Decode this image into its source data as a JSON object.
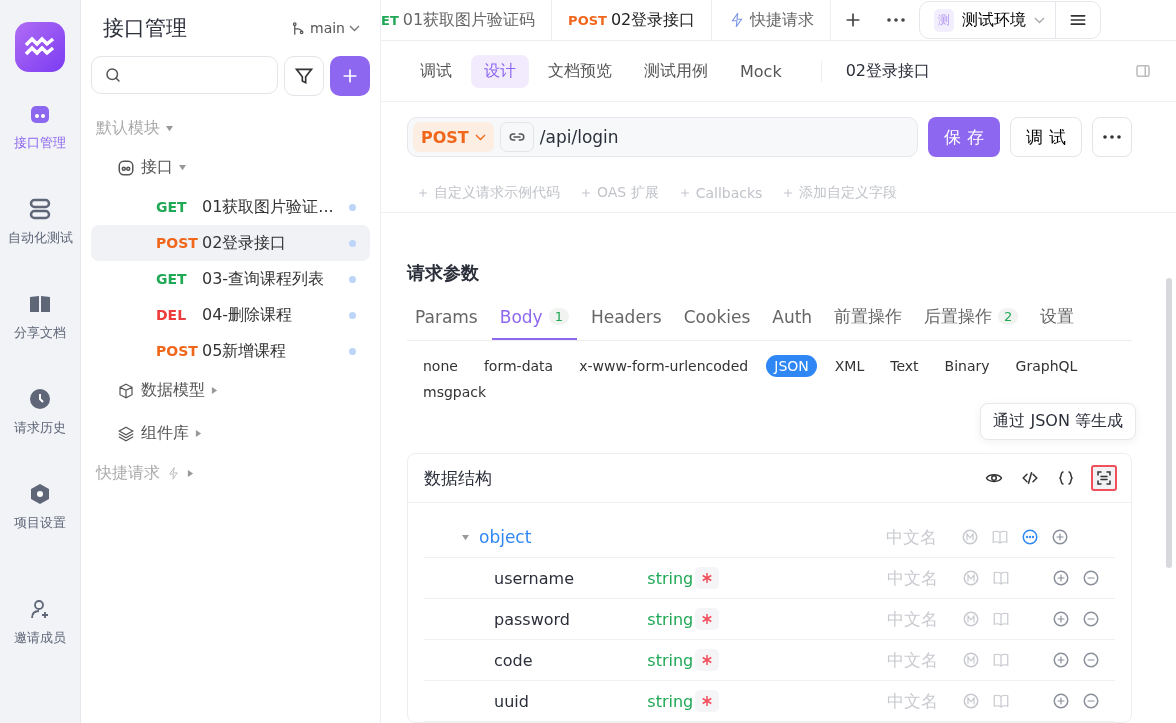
{
  "rail": {
    "items": [
      {
        "label": "接口管理",
        "selected": true
      },
      {
        "label": "自动化测试",
        "selected": false
      },
      {
        "label": "分享文档",
        "selected": false
      },
      {
        "label": "请求历史",
        "selected": false
      },
      {
        "label": "项目设置",
        "selected": false
      },
      {
        "label": "邀请成员",
        "selected": false
      }
    ]
  },
  "sidebar": {
    "title": "接口管理",
    "branch": "main",
    "tree": [
      {
        "label": "默认模块",
        "kind": "module",
        "children": [
          {
            "label": "接口",
            "kind": "folder",
            "expanded": true,
            "children": [
              {
                "method": "GET",
                "label": "01获取图片验证...",
                "selected": false
              },
              {
                "method": "POST",
                "label": "02登录接口",
                "selected": true
              },
              {
                "method": "GET",
                "label": "03-查询课程列表",
                "selected": false
              },
              {
                "method": "DEL",
                "label": "04-删除课程",
                "selected": false
              },
              {
                "method": "POST",
                "label": "05新增课程",
                "selected": false
              }
            ]
          },
          {
            "label": "数据模型",
            "kind": "folder",
            "expanded": false
          },
          {
            "label": "组件库",
            "kind": "folder",
            "expanded": false
          }
        ]
      },
      {
        "label": "快捷请求",
        "kind": "quick"
      }
    ]
  },
  "tabs": [
    {
      "method": "ET",
      "label": "01获取图片验证码",
      "selected": false
    },
    {
      "method": "POST",
      "label": "02登录接口",
      "selected": true
    },
    {
      "label": "快捷请求",
      "selected": false,
      "kind": "quick"
    }
  ],
  "environment": {
    "badge": "测",
    "label": "测试环境"
  },
  "subtabs": [
    {
      "label": "调试",
      "selected": false
    },
    {
      "label": "设计",
      "selected": true
    },
    {
      "label": "文档预览",
      "selected": false
    },
    {
      "label": "测试用例",
      "selected": false
    },
    {
      "label": "Mock",
      "selected": false
    }
  ],
  "doc_title": "02登录接口",
  "request": {
    "method": "POST",
    "url": "/api/login",
    "save": "保 存",
    "debug": "调 试"
  },
  "extensions": [
    "自定义请求示例代码",
    "OAS 扩展",
    "Callbacks",
    "添加自定义字段"
  ],
  "params": {
    "title": "请求参数",
    "tabs": [
      {
        "label": "Params",
        "selected": false
      },
      {
        "label": "Body",
        "count": "1",
        "selected": true
      },
      {
        "label": "Headers",
        "selected": false
      },
      {
        "label": "Cookies",
        "selected": false
      },
      {
        "label": "Auth",
        "selected": false
      },
      {
        "label": "前置操作",
        "selected": false
      },
      {
        "label": "后置操作",
        "count": "2",
        "selected": false
      },
      {
        "label": "设置",
        "selected": false
      }
    ],
    "body_types": [
      {
        "label": "none",
        "selected": false
      },
      {
        "label": "form-data",
        "selected": false
      },
      {
        "label": "x-www-form-urlencoded",
        "selected": false
      },
      {
        "label": "JSON",
        "selected": true
      },
      {
        "label": "XML",
        "selected": false
      },
      {
        "label": "Text",
        "selected": false
      },
      {
        "label": "Binary",
        "selected": false
      },
      {
        "label": "GraphQL",
        "selected": false
      },
      {
        "label": "msgpack",
        "selected": false
      }
    ],
    "tooltip": "通过 JSON 等生成",
    "schema": {
      "title": "数据结构",
      "root": {
        "name": "object",
        "placeholder": "中文名"
      },
      "fields": [
        {
          "name": "username",
          "type": "string",
          "required": true,
          "placeholder": "中文名"
        },
        {
          "name": "password",
          "type": "string",
          "required": true,
          "placeholder": "中文名"
        },
        {
          "name": "code",
          "type": "string",
          "required": true,
          "placeholder": "中文名"
        },
        {
          "name": "uuid",
          "type": "string",
          "required": true,
          "placeholder": "中文名"
        }
      ]
    }
  }
}
